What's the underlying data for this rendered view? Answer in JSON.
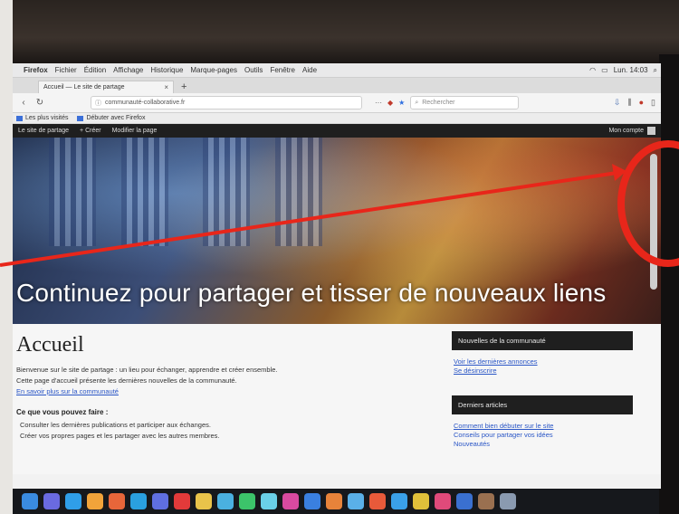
{
  "menubar": {
    "app": "Firefox",
    "items": [
      "Fichier",
      "Édition",
      "Affichage",
      "Historique",
      "Marque-pages",
      "Outils",
      "Fenêtre",
      "Aide"
    ],
    "status": "Lun. 14:03"
  },
  "browser": {
    "tab_title": "Accueil — Le site de partage",
    "url": "communauté-collaborative.fr",
    "search_placeholder": "Rechercher",
    "bookmarks": [
      "Les plus visités",
      "Débuter avec Firefox"
    ]
  },
  "adminbar": {
    "site_name": "Le site de partage",
    "new_label": "+ Créer",
    "edit_label": "Modifier la page",
    "user_label": "Mon compte"
  },
  "hero": {
    "headline": "Continuez pour partager et tisser de nouveaux liens"
  },
  "page": {
    "title": "Accueil",
    "intro_lines": [
      "Bienvenue sur le site de partage : un lieu pour échanger, apprendre et créer ensemble.",
      "Cette page d'accueil présente les dernières nouvelles de la communauté."
    ],
    "intro_link": "En savoir plus sur la communauté",
    "list_heading": "Ce que vous pouvez faire :",
    "list_items": [
      "Consulter les dernières publications et participer aux échanges.",
      "Créer vos propres pages et les partager avec les autres membres."
    ]
  },
  "sidebar": {
    "widget1_title": "Nouvelles de la communauté",
    "widget1_lines": [
      "Voir les dernières annonces",
      "Se désinscrire"
    ],
    "widget2_title": "Derniers articles",
    "widget2_lines": [
      "Comment bien débuter sur le site",
      "Conseils pour partager vos idées",
      "Nouveautés"
    ]
  },
  "colors": {
    "annotation": "#e8261a",
    "link": "#2a56c6",
    "adminbar": "#1f1f1f"
  }
}
